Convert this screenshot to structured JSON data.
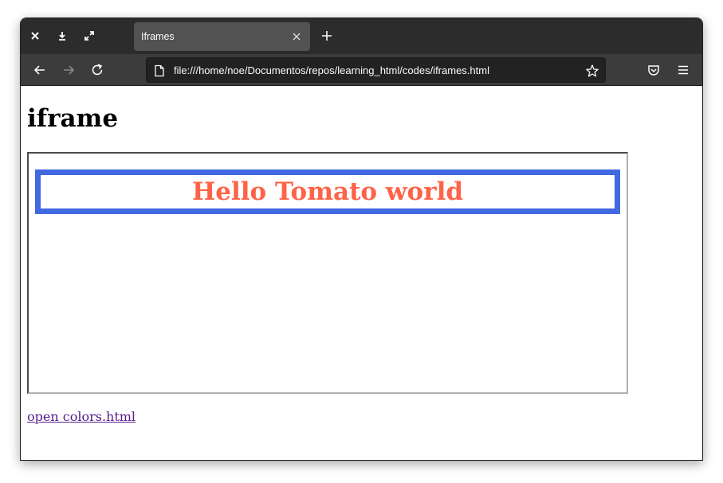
{
  "window": {
    "controls": [
      "close-icon",
      "download-icon",
      "maximize-icon"
    ]
  },
  "tab": {
    "title": "Iframes",
    "close_icon": "close-icon"
  },
  "toolbar": {
    "new_tab_icon": "plus-icon",
    "back_icon": "arrow-left-icon",
    "forward_icon": "arrow-right-icon",
    "reload_icon": "reload-icon",
    "url": "file:///home/noe/Documentos/repos/learning_html/codes/iframes.html",
    "page_icon": "file-icon",
    "bookmark_icon": "star-icon",
    "pocket_icon": "pocket-icon",
    "menu_icon": "hamburger-menu-icon"
  },
  "page": {
    "heading": "iframe",
    "iframe": {
      "text": "Hello Tomato world",
      "text_color": "#ff6347",
      "border_color": "#4169e1"
    },
    "link": "open colors.html",
    "link_color": "#551a8b"
  }
}
